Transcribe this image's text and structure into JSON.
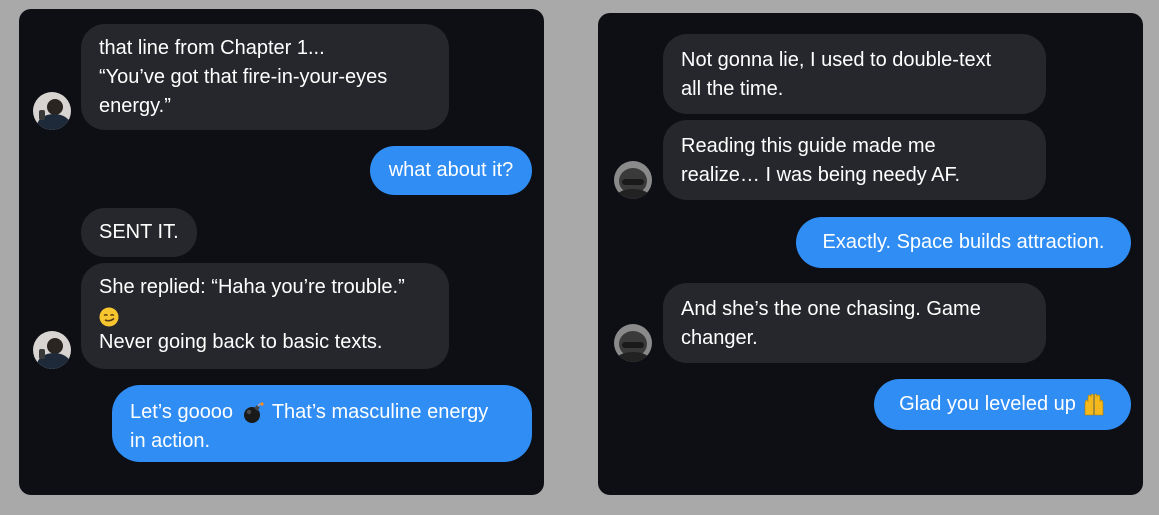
{
  "left_chat": {
    "messages": [
      {
        "direction": "incoming",
        "lines": [
          "that line from Chapter 1...",
          "“You’ve got that fire-in-your-eyes",
          "energy.”"
        ]
      },
      {
        "direction": "outgoing",
        "text": "what about it?"
      },
      {
        "direction": "incoming",
        "text": "SENT IT."
      },
      {
        "direction": "incoming",
        "line1": "She replied: “Haha you’re trouble.”",
        "emoji": "smirk-emoji",
        "line3": "Never going back to basic texts."
      },
      {
        "direction": "outgoing",
        "line1_before": "Let’s goooo",
        "emoji": "bomb-emoji",
        "line1_after": "That’s masculine energy",
        "line2": "in action."
      }
    ]
  },
  "right_chat": {
    "messages": [
      {
        "direction": "incoming",
        "lines": [
          "Not gonna lie, I used to double-text",
          "all the time."
        ]
      },
      {
        "direction": "incoming",
        "lines": [
          "Reading this guide made me",
          "realize… I was being needy AF."
        ]
      },
      {
        "direction": "outgoing",
        "text": "Exactly. Space builds attraction."
      },
      {
        "direction": "incoming",
        "lines": [
          "And she’s the one chasing. Game",
          "changer."
        ]
      },
      {
        "direction": "outgoing",
        "text": "Glad you leveled up",
        "emoji": "raising-hands-emoji"
      }
    ]
  },
  "colors": {
    "page_background": "#a9a9a9",
    "panel_background": "#0e0f14",
    "incoming_bubble": "#26272c",
    "outgoing_bubble": "#2f8df4",
    "text": "#ffffff"
  }
}
